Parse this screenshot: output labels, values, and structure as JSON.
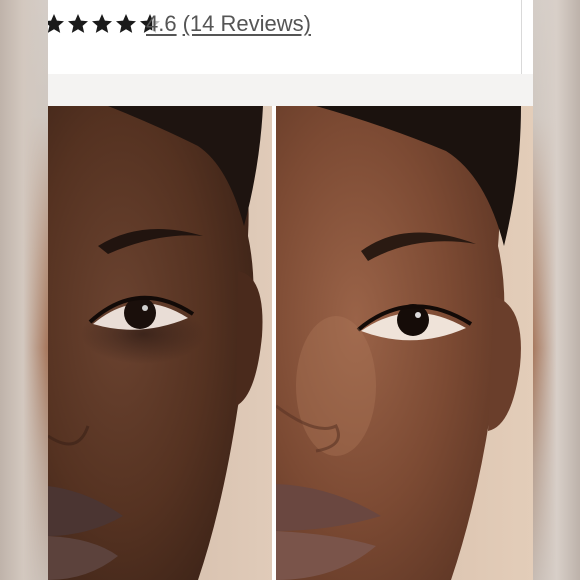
{
  "rating": {
    "stars_value": 4.6,
    "stars_max": 5,
    "score": "4.6",
    "reviews": "(14 Reviews)",
    "star_color": "#1a1a1a",
    "empty_star_color": "#bdbdbd"
  },
  "photos": {
    "before_skin_color": "#5a3524",
    "after_skin_color": "#7a4a32",
    "background_color": "#d9c0ab"
  }
}
